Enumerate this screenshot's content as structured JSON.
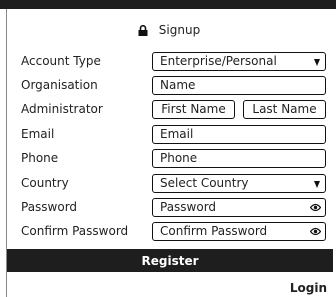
{
  "header": {
    "title": "Signup",
    "icon": "lock-icon"
  },
  "form": {
    "account_type": {
      "label": "Account Type",
      "value": "Enterprise/Personal"
    },
    "organisation": {
      "label": "Organisation",
      "placeholder": "Name"
    },
    "administrator": {
      "label": "Administrator",
      "first_placeholder": "First Name",
      "last_placeholder": "Last Name"
    },
    "email": {
      "label": "Email",
      "placeholder": "Email"
    },
    "phone": {
      "label": "Phone",
      "placeholder": "Phone"
    },
    "country": {
      "label": "Country",
      "value": "Select Country"
    },
    "password": {
      "label": "Password",
      "placeholder": "Password"
    },
    "confirm_password": {
      "label": "Confirm Password",
      "placeholder": "Confirm Password"
    }
  },
  "actions": {
    "register_label": "Register",
    "login_label": "Login"
  },
  "colors": {
    "bar": "#1e1e1e",
    "border": "#111111",
    "background": "#ffffff"
  }
}
